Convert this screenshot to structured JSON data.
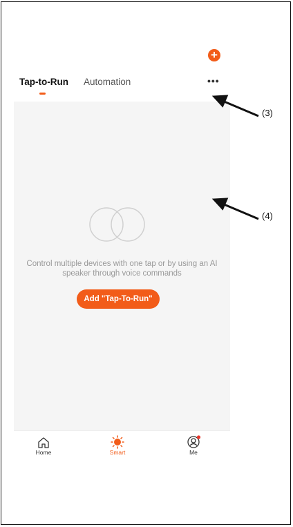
{
  "header": {
    "add_icon": "plus-circle-icon",
    "accent_color": "#f25c19"
  },
  "tabs": [
    {
      "label": "Tap-to-Run",
      "active": true
    },
    {
      "label": "Automation",
      "active": false
    }
  ],
  "more_icon": "ellipsis-horizontal-icon",
  "empty_state": {
    "icon": "two-circles-icon",
    "message": "Control multiple devices with one tap or by using an AI speaker through voice commands",
    "button_label": "Add \"Tap-To-Run\""
  },
  "bottom_nav": [
    {
      "label": "Home",
      "icon": "home-icon",
      "active": false
    },
    {
      "label": "Smart",
      "icon": "sun-icon",
      "active": true
    },
    {
      "label": "Me",
      "icon": "user-icon",
      "active": false,
      "badge": true
    }
  ],
  "annotations": {
    "a3": "(3)",
    "a4": "(4)"
  }
}
